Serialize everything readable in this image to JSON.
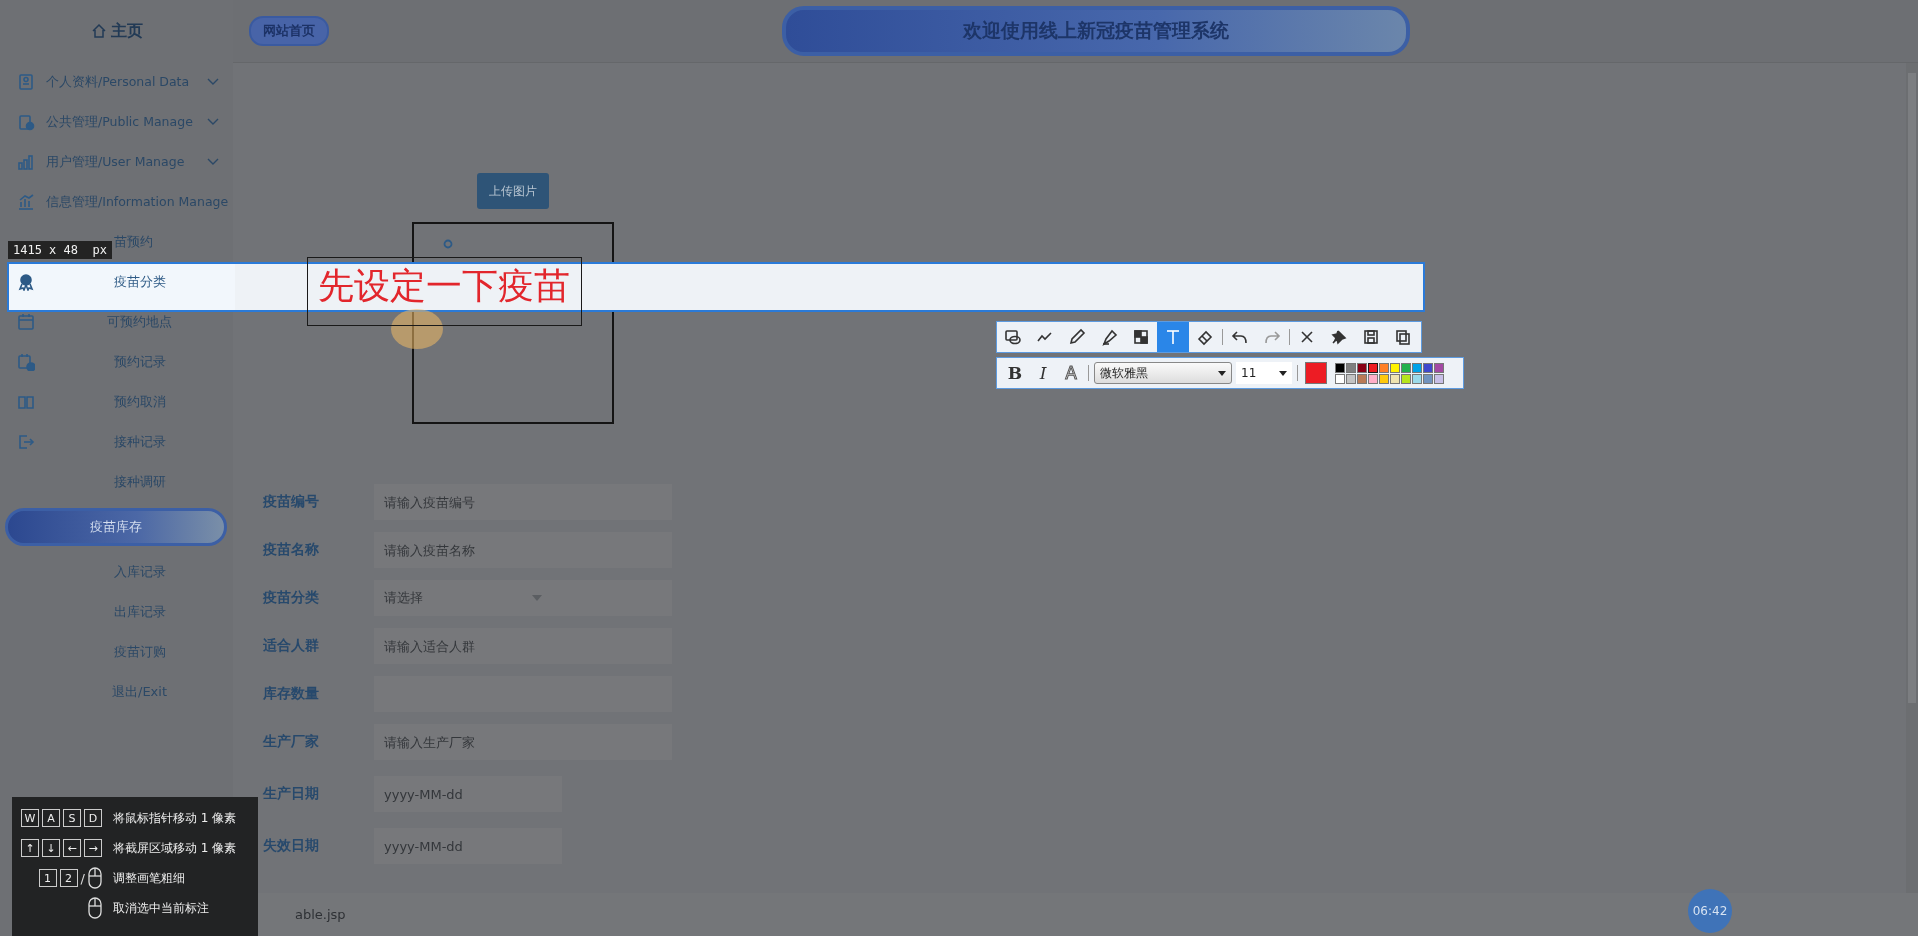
{
  "sidebar": {
    "home": "主页",
    "items": [
      {
        "label": "个人资料/Personal Data",
        "kind": "group"
      },
      {
        "label": "公共管理/Public Manage",
        "kind": "group"
      },
      {
        "label": "用户管理/User Manage",
        "kind": "group"
      },
      {
        "label": "信息管理/Information Manage",
        "kind": "group"
      },
      {
        "label": "苗预约",
        "kind": "covered"
      },
      {
        "label": "疫苗分类",
        "kind": "captured"
      },
      {
        "label": "可预约地点",
        "kind": "link"
      },
      {
        "label": "预约记录",
        "kind": "link"
      },
      {
        "label": "预约取消",
        "kind": "link"
      },
      {
        "label": "接种记录",
        "kind": "link"
      },
      {
        "label": "接种调研",
        "kind": "link"
      },
      {
        "label": "疫苗库存",
        "kind": "active"
      },
      {
        "label": "入库记录",
        "kind": "link"
      },
      {
        "label": "出库记录",
        "kind": "link"
      },
      {
        "label": "疫苗订购",
        "kind": "link"
      },
      {
        "label": "退出/Exit",
        "kind": "link"
      }
    ]
  },
  "header": {
    "home_link": "网站首页",
    "title": "欢迎使用线上新冠疫苗管理系统"
  },
  "upload_button": "上传图片",
  "form": [
    {
      "label": "疫苗编号",
      "kind": "text",
      "placeholder": "请输入疫苗编号"
    },
    {
      "label": "疫苗名称",
      "kind": "text",
      "placeholder": "请输入疫苗名称"
    },
    {
      "label": "疫苗分类",
      "kind": "select",
      "value": "请选择"
    },
    {
      "label": "适合人群",
      "kind": "text",
      "placeholder": "请输入适合人群"
    },
    {
      "label": "库存数量",
      "kind": "text"
    },
    {
      "label": "生产厂家",
      "kind": "text",
      "placeholder": "请输入生产厂家"
    },
    {
      "label": "生产日期",
      "kind": "date",
      "placeholder": "yyyy-MM-dd"
    },
    {
      "label": "失效日期",
      "kind": "date",
      "placeholder": "yyyy-MM-dd"
    }
  ],
  "status_bar": {
    "url": "able.jsp"
  },
  "clock": "06:42",
  "capture": {
    "size_label": "1415 x 48  px",
    "annotation": "先设定一下疫苗",
    "tools": [
      {
        "selected": false
      },
      {
        "selected": false
      },
      {
        "selected": false
      },
      {
        "selected": false
      },
      {
        "selected": false
      },
      {
        "selected": true
      },
      {
        "selected": false
      },
      {
        "selected": false
      },
      {
        "selected": false
      },
      {
        "selected": false
      },
      {
        "selected": false
      },
      {
        "selected": false
      },
      {
        "selected": false
      }
    ],
    "format_buttons": [
      "B",
      "I",
      "A"
    ],
    "font": "微软雅黑",
    "font_size": "11",
    "palette": [
      {
        "color": "#000000",
        "selected": false
      },
      {
        "color": "#7f7f7f",
        "selected": false
      },
      {
        "color": "#880015",
        "selected": false
      },
      {
        "color": "#ed1c24",
        "selected": true
      },
      {
        "color": "#ff7f27",
        "selected": false
      },
      {
        "color": "#fff200",
        "selected": false
      },
      {
        "color": "#22b14c",
        "selected": false
      },
      {
        "color": "#00a2e8",
        "selected": false
      },
      {
        "color": "#3f48cc",
        "selected": false
      },
      {
        "color": "#a349a4",
        "selected": false
      },
      {
        "color": "#ffffff",
        "selected": false
      },
      {
        "color": "#c3c3c3",
        "selected": false
      },
      {
        "color": "#b97a57",
        "selected": false
      },
      {
        "color": "#ffaec9",
        "selected": false
      },
      {
        "color": "#ffc90e",
        "selected": false
      },
      {
        "color": "#efe4b0",
        "selected": false
      },
      {
        "color": "#b5e61d",
        "selected": false
      },
      {
        "color": "#99d9ea",
        "selected": false
      },
      {
        "color": "#7092be",
        "selected": false
      },
      {
        "color": "#c8bfe7",
        "selected": false
      }
    ],
    "shortcuts": [
      {
        "kind": "keys",
        "keys": [
          "W",
          "A",
          "S",
          "D"
        ],
        "text": "将鼠标指针移动 1 像素"
      },
      {
        "kind": "keys",
        "keys": [
          "↑",
          "↓",
          "←",
          "→"
        ],
        "text": "将截屏区域移动 1 像素"
      },
      {
        "kind": "keys_or_mouse",
        "keys": [
          "1",
          "2"
        ],
        "separator": "/",
        "text": "调整画笔粗细"
      },
      {
        "kind": "mouse",
        "text": "取消选中当前标注"
      }
    ]
  }
}
